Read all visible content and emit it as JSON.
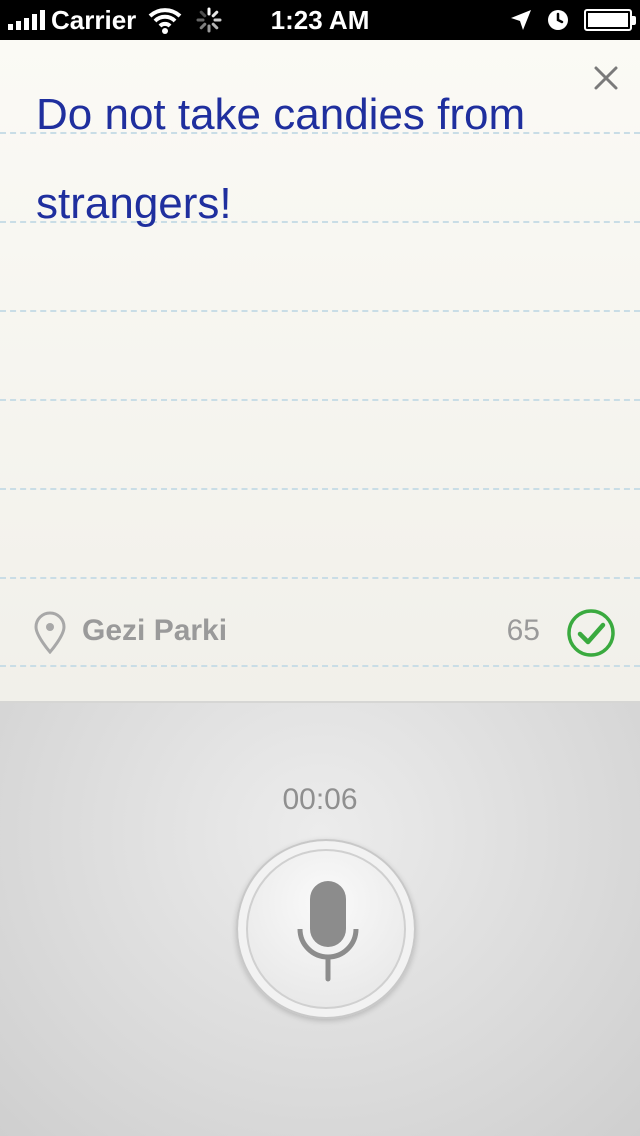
{
  "status_bar": {
    "carrier": "Carrier",
    "time": "1:23 AM",
    "battery_level": 1.0
  },
  "note": {
    "text": "Do not take candies from strangers!",
    "location": "Gezi Parki",
    "char_count": "65",
    "text_color": "#1f2f9e",
    "rule_color": "#c9dde6",
    "confirm_color": "#3aaa3f"
  },
  "recorder": {
    "elapsed": "00:06"
  },
  "icons": [
    "signal-icon",
    "wifi-icon",
    "activity-spinner-icon",
    "location-arrow-icon",
    "alarm-clock-icon",
    "battery-icon",
    "close-icon",
    "location-pin-icon",
    "checkmark-icon",
    "microphone-icon"
  ]
}
